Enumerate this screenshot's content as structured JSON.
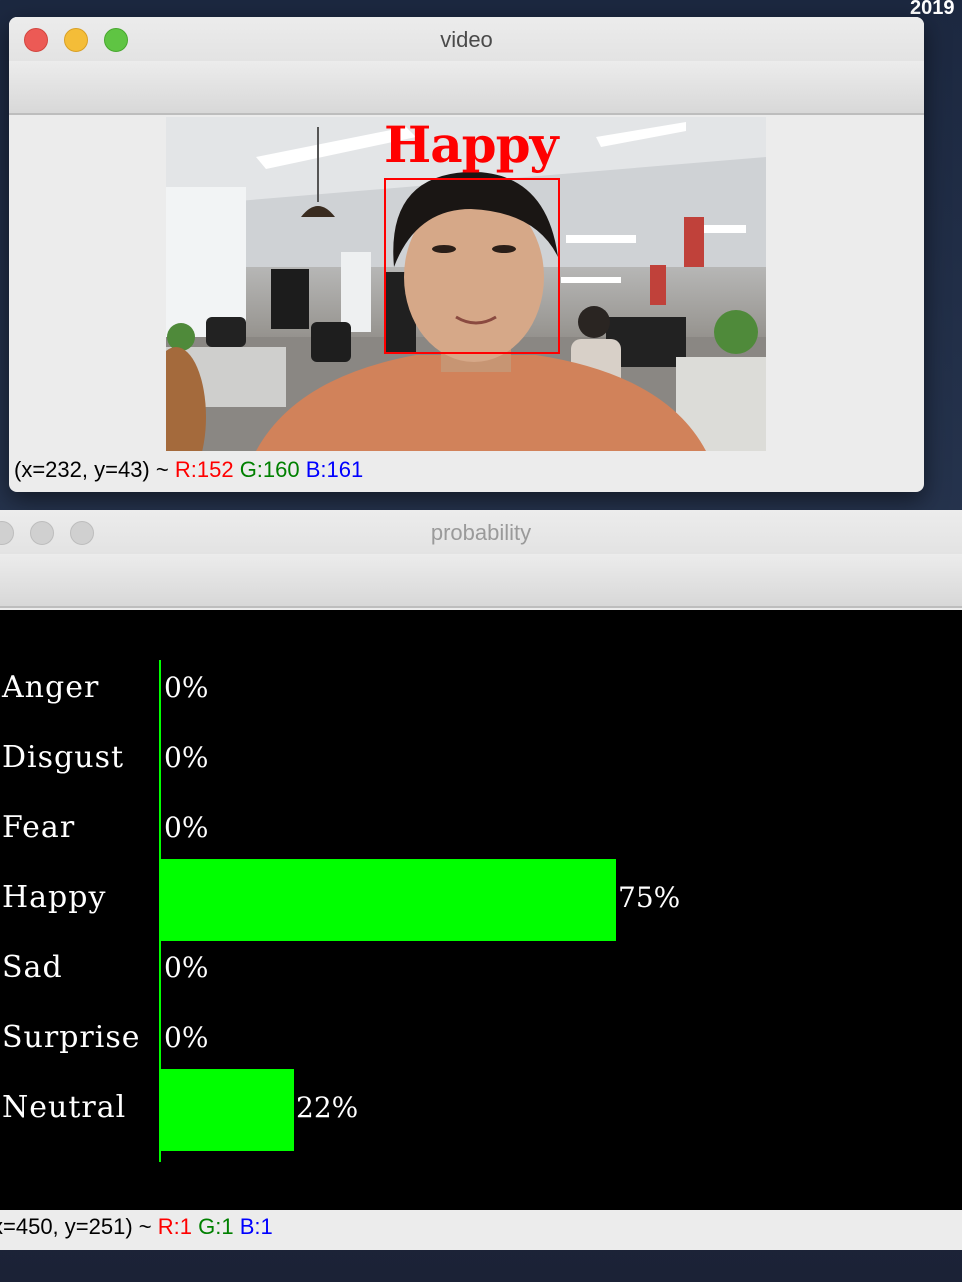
{
  "desktop": {
    "corner_text": "2019"
  },
  "video_window": {
    "title": "video",
    "emotion_label": "Happy",
    "status": {
      "coords": "(x=232, y=43) ~",
      "r": "R:152",
      "g": "G:160",
      "b": "B:161"
    }
  },
  "probability_window": {
    "title": "probability",
    "bar_color": "#00ff00",
    "status": {
      "coords": "x=450, y=251) ~",
      "r": "R:1",
      "g": "G:1",
      "b": "B:1"
    }
  },
  "chart_data": {
    "type": "bar",
    "orientation": "horizontal",
    "categories": [
      "Anger",
      "Disgust",
      "Fear",
      "Happy",
      "Sad",
      "Surprise",
      "Neutral"
    ],
    "values": [
      0,
      0,
      0,
      75,
      0,
      0,
      22
    ],
    "value_labels": [
      "0%",
      "0%",
      "0%",
      "75%",
      "0%",
      "0%",
      "22%"
    ],
    "xlim": [
      0,
      100
    ]
  }
}
